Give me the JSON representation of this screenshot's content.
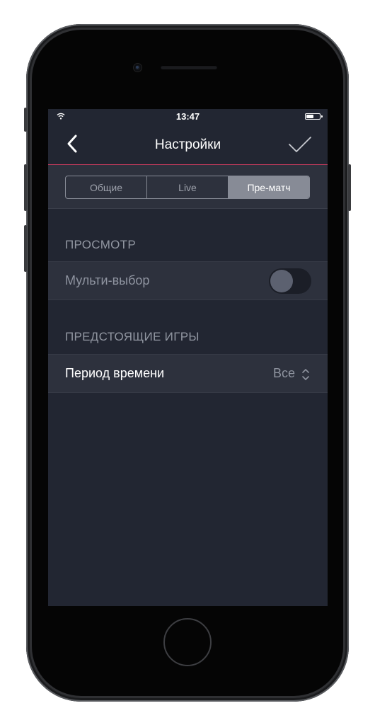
{
  "status_bar": {
    "time": "13:47"
  },
  "navbar": {
    "title": "Настройки"
  },
  "tabs": [
    {
      "label": "Общие",
      "active": false
    },
    {
      "label": "Live",
      "active": false
    },
    {
      "label": "Пре-матч",
      "active": true
    }
  ],
  "sections": {
    "view": {
      "header": "ПРОСМОТР",
      "multi_select": {
        "label": "Мульти-выбор",
        "enabled": false
      }
    },
    "upcoming": {
      "header": "ПРЕДСТОЯЩИЕ ИГРЫ",
      "time_period": {
        "label": "Период времени",
        "value": "Все"
      }
    }
  },
  "colors": {
    "background": "#222632",
    "row_background": "#2d313d",
    "accent_line": "#c23a5c",
    "segment_active": "#878b96"
  }
}
